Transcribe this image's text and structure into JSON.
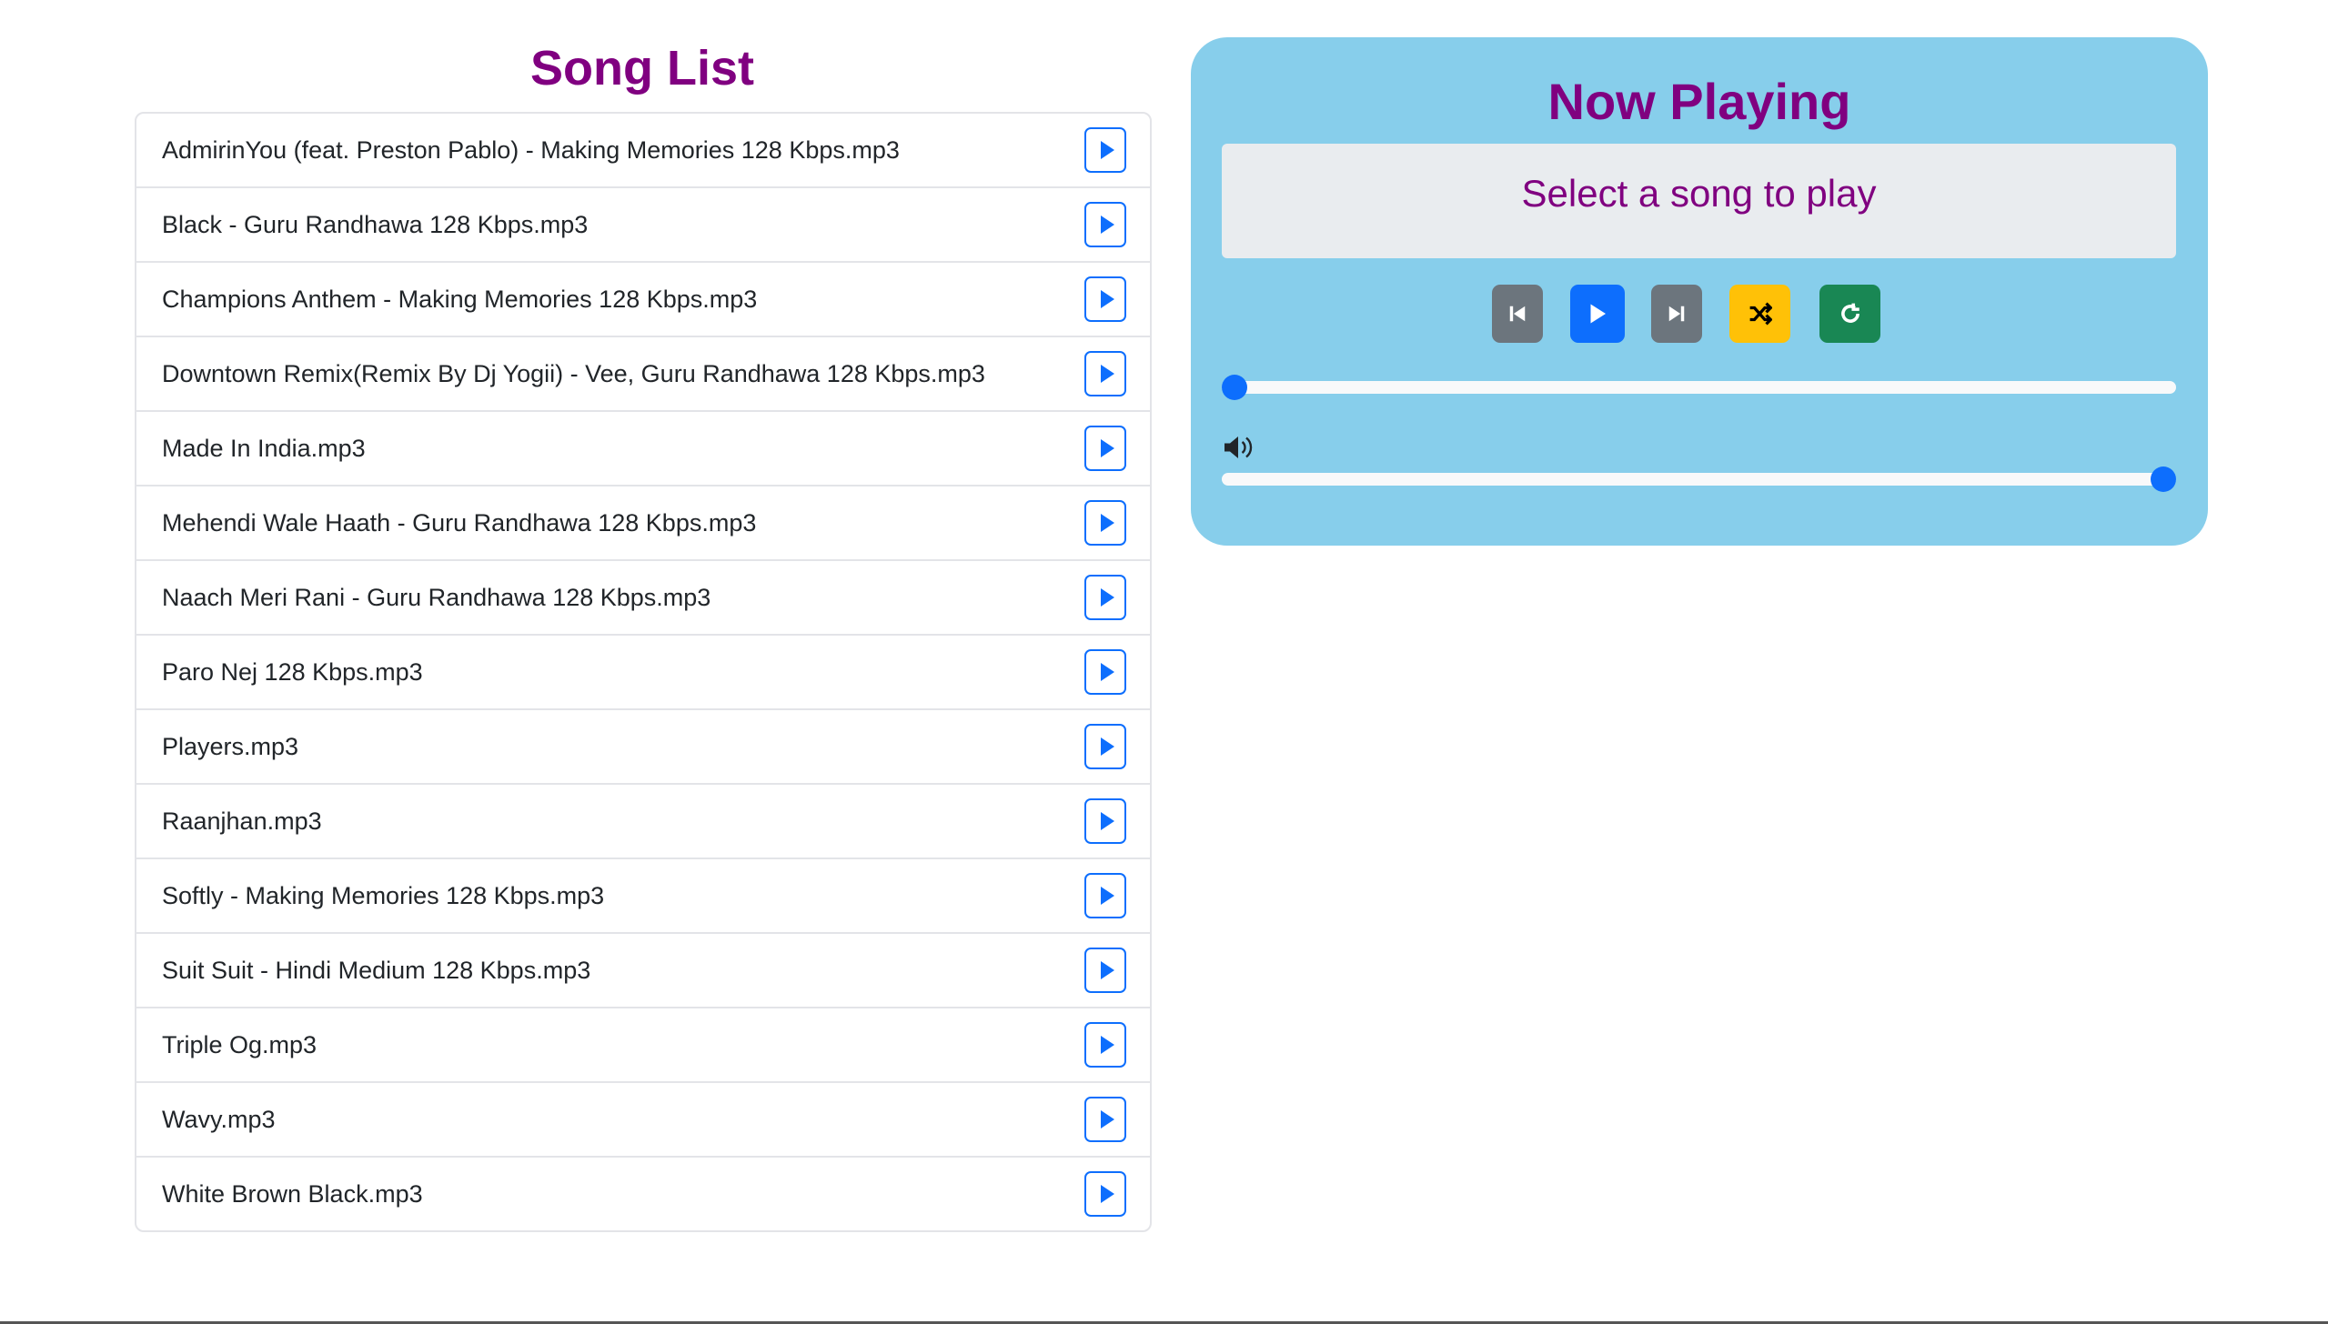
{
  "song_list": {
    "title": "Song List",
    "songs": [
      "AdmirinYou (feat. Preston Pablo) - Making Memories 128 Kbps.mp3",
      "Black - Guru Randhawa 128 Kbps.mp3",
      "Champions Anthem - Making Memories 128 Kbps.mp3",
      "Downtown Remix(Remix By Dj Yogii) - Vee, Guru Randhawa 128 Kbps.mp3",
      "Made In India.mp3",
      "Mehendi Wale Haath - Guru Randhawa 128 Kbps.mp3",
      "Naach Meri Rani - Guru Randhawa 128 Kbps.mp3",
      "Paro Nej 128 Kbps.mp3",
      "Players.mp3",
      "Raanjhan.mp3",
      "Softly - Making Memories 128 Kbps.mp3",
      "Suit Suit - Hindi Medium 128 Kbps.mp3",
      "Triple Og.mp3",
      "Wavy.mp3",
      "White Brown Black.mp3"
    ]
  },
  "player": {
    "title": "Now Playing",
    "current_song": "Select a song to play",
    "progress_percent": 0,
    "volume_percent": 100,
    "colors": {
      "prev": "#6c757d",
      "play": "#0d6efd",
      "next": "#6c757d",
      "shuffle": "#ffc107",
      "repeat": "#198754",
      "panel": "#87ceeb",
      "title": "#800080"
    }
  }
}
